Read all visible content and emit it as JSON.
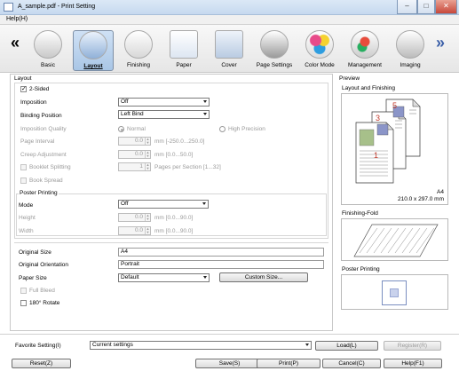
{
  "window": {
    "title": "A_sample.pdf - Print Setting",
    "minimize": "‒",
    "maximize": "□",
    "close": "✕"
  },
  "menu": {
    "help": "Help(H)"
  },
  "tabs": [
    {
      "label": "Basic",
      "icon": "basic-icon"
    },
    {
      "label": "Layout",
      "icon": "layout-icon",
      "selected": true
    },
    {
      "label": "Finishing",
      "icon": "finishing-icon"
    },
    {
      "label": "Paper",
      "icon": "paper-icon"
    },
    {
      "label": "Cover",
      "icon": "cover-icon"
    },
    {
      "label": "Page Settings",
      "icon": "page-settings-icon"
    },
    {
      "label": "Color Mode",
      "icon": "color-mode-icon"
    },
    {
      "label": "Management",
      "icon": "management-icon"
    },
    {
      "label": "Imaging",
      "icon": "imaging-icon"
    }
  ],
  "nav": {
    "prev": "«",
    "next": "»"
  },
  "layout": {
    "group_title": "Layout",
    "two_sided": {
      "label": "2-Sided",
      "checked": true,
      "mark": "✓"
    },
    "imposition": {
      "label": "Imposition",
      "value": "Off"
    },
    "binding_position": {
      "label": "Binding Position",
      "value": "Left Bind"
    },
    "imposition_quality": {
      "label": "Imposition Quality",
      "normal": "Normal",
      "high": "High Precision"
    },
    "page_interval": {
      "label": "Page Interval",
      "value": "0.0",
      "range": "mm [-250.0...250.0]"
    },
    "creep_adjustment": {
      "label": "Creep Adjustment",
      "value": "0.0",
      "range": "mm [0.0...50.0]"
    },
    "booklet_splitting": {
      "label": "Booklet Splitting",
      "value": "1",
      "range": "Pages per Section [1...32]"
    },
    "book_spread": {
      "label": "Book Spread"
    }
  },
  "poster": {
    "group_title": "Poster Printing",
    "mode": {
      "label": "Mode",
      "value": "Off"
    },
    "height": {
      "label": "Height",
      "value": "0.0",
      "range": "mm [0.0...90.0]"
    },
    "width": {
      "label": "Width",
      "value": "0.0",
      "range": "mm [0.0...90.0]"
    }
  },
  "paper": {
    "original_size": {
      "label": "Original Size",
      "value": "A4"
    },
    "original_orientation": {
      "label": "Original Orientation",
      "value": "Portrait"
    },
    "paper_size": {
      "label": "Paper Size",
      "value": "Default"
    },
    "custom_size_button": "Custom Size...",
    "full_bleed": {
      "label": "Full Bleed"
    },
    "rotate_180": {
      "label": "180° Rotate"
    }
  },
  "preview": {
    "title": "Preview",
    "layout_finishing": "Layout and Finishing",
    "paper_name": "A4",
    "paper_dims": "210.0 x 297.0 mm",
    "page_numbers": [
      "5",
      "3",
      "1"
    ],
    "finishing_fold": "Finishing-Fold",
    "poster_printing": "Poster Printing"
  },
  "favorite": {
    "label": "Favorite Setting(I)",
    "value": "Current settings",
    "load": "Load(L)",
    "register": "Register(R)"
  },
  "buttons": {
    "reset": "Reset(Z)",
    "save": "Save(S)",
    "print": "Print(P)",
    "cancel": "Cancel(C)",
    "help": "Help(F1)"
  },
  "colors": {
    "accent": "#3b5fa8",
    "page_number": "#c0392b"
  }
}
